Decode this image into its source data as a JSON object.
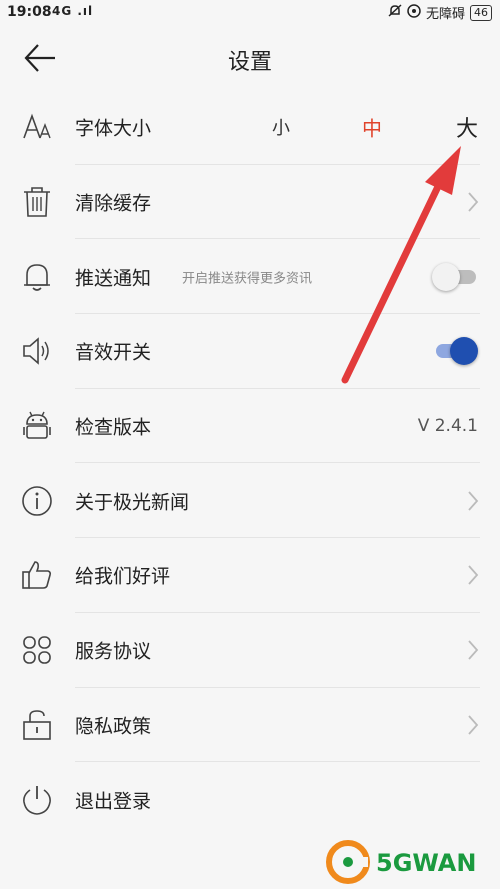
{
  "status_bar": {
    "time": "19:08",
    "signal": "4G .ıl",
    "network_text": "无障碍",
    "battery": "46"
  },
  "header": {
    "title": "设置"
  },
  "rows": {
    "font_size": {
      "label": "字体大小",
      "small": "小",
      "medium": "中",
      "large": "大",
      "selected": "中"
    },
    "clear_cache": {
      "label": "清除缓存"
    },
    "push": {
      "label": "推送通知",
      "hint": "开启推送获得更多资讯",
      "enabled": false
    },
    "sound": {
      "label": "音效开关",
      "enabled": true
    },
    "version": {
      "label": "检查版本",
      "value": "V 2.4.1"
    },
    "about": {
      "label": "关于极光新闻"
    },
    "rate": {
      "label": "给我们好评"
    },
    "terms": {
      "label": "服务协议"
    },
    "privacy": {
      "label": "隐私政策"
    },
    "logout": {
      "label": "退出登录"
    }
  },
  "colors": {
    "accent": "#e0432b",
    "toggle_on": "#1f4fb0",
    "arrow": "#e23b3b"
  },
  "watermark": {
    "text": "5GWAN"
  }
}
